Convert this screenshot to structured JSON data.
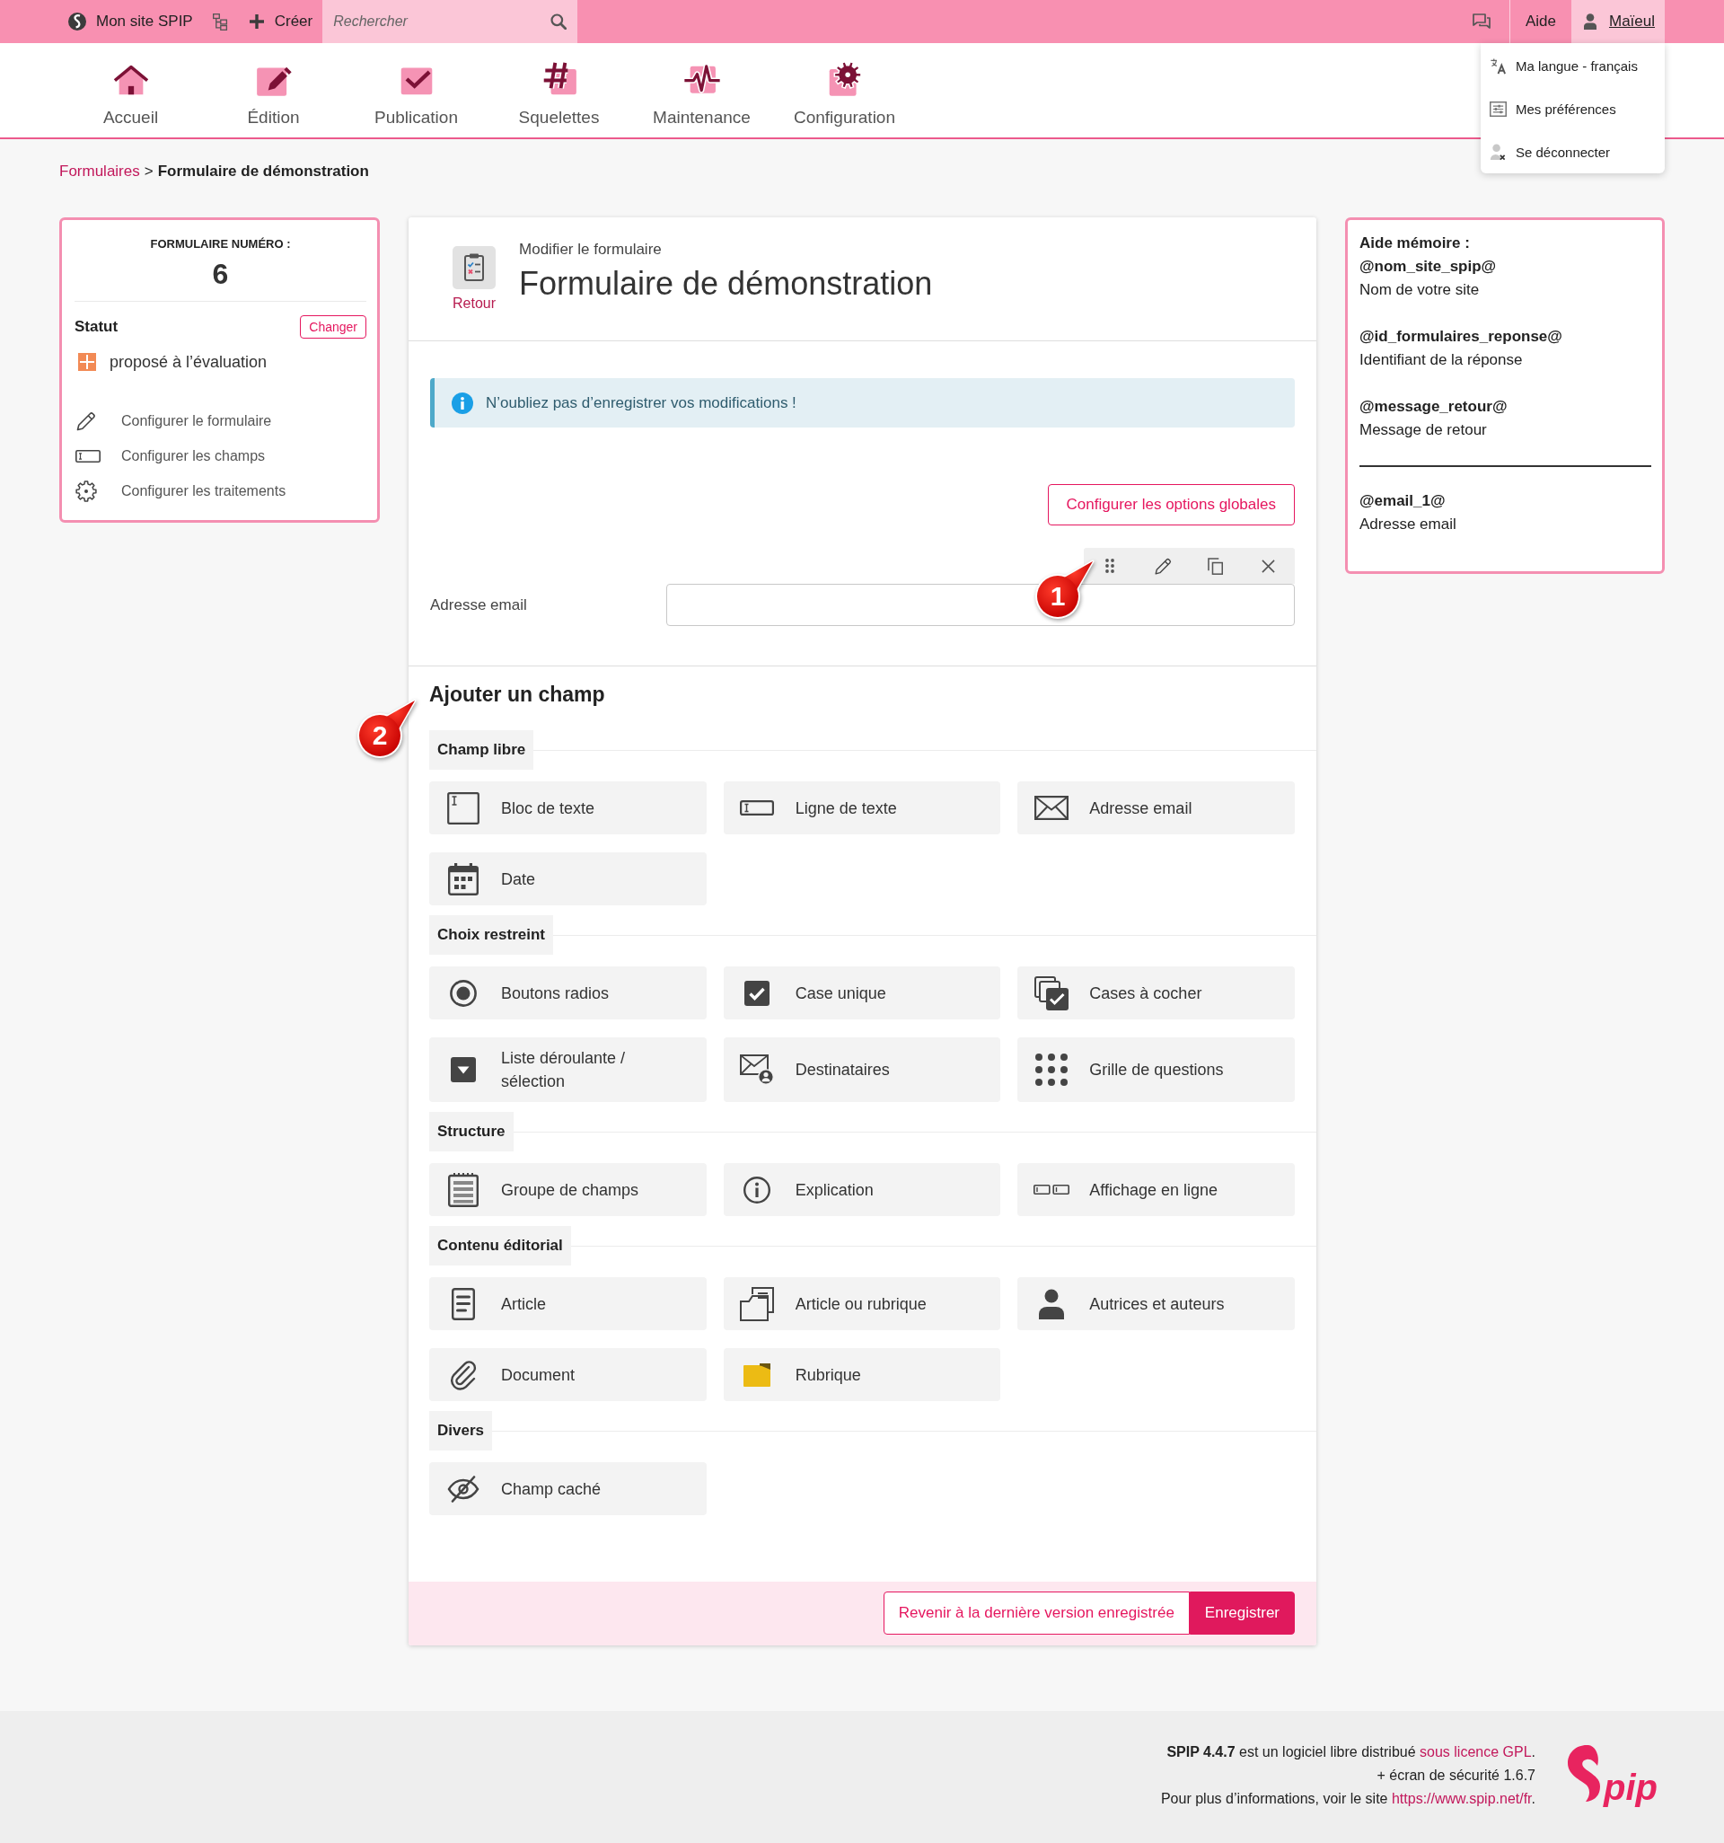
{
  "topbar": {
    "site": "Mon site SPIP",
    "create": "Créer",
    "search": {
      "placeholder": "Rechercher"
    },
    "help": "Aide",
    "user": {
      "name": "Maïeul",
      "expanded": true,
      "menu": [
        "Ma langue - français",
        "Mes préférences",
        "Se déconnecter"
      ]
    }
  },
  "nav": [
    {
      "label": "Accueil",
      "kind": "home"
    },
    {
      "label": "Édition",
      "kind": "edit"
    },
    {
      "label": "Publication",
      "kind": "publish"
    },
    {
      "label": "Squelettes",
      "kind": "templates"
    },
    {
      "label": "Maintenance",
      "kind": "maintenance"
    },
    {
      "label": "Configuration",
      "kind": "config"
    }
  ],
  "breadcrumb": {
    "parent": "Formulaires",
    "separator": ">",
    "current": "Formulaire de démonstration"
  },
  "form_card": {
    "heading": "FORMULAIRE NUMÉRO :",
    "number": "6",
    "status_label": "Statut",
    "change": "Changer",
    "status": "proposé à l’évaluation",
    "actions": [
      {
        "label": "Configurer le formulaire",
        "kind": "edit"
      },
      {
        "label": "Configurer les champs",
        "kind": "fields"
      },
      {
        "label": "Configurer les traitements",
        "kind": "processing"
      }
    ]
  },
  "editor": {
    "back": "Retour",
    "subtitle": "Modifier le formulaire",
    "title": "Formulaire de démonstration",
    "alert": "N’oubliez pas d’enregistrer vos modifications !",
    "global_options": "Configurer les options globales",
    "fields": [
      {
        "label": "Adresse email"
      }
    ],
    "add_title": "Ajouter un champ",
    "sections": [
      {
        "title": "Champ libre",
        "items": [
          {
            "label": "Bloc de texte",
            "kind": "textarea"
          },
          {
            "label": "Ligne de texte",
            "kind": "input"
          },
          {
            "label": "Adresse email",
            "kind": "email"
          },
          {
            "label": "Date",
            "kind": "date"
          }
        ]
      },
      {
        "title": "Choix restreint",
        "items": [
          {
            "label": "Boutons radios",
            "kind": "radio"
          },
          {
            "label": "Case unique",
            "kind": "checkbox"
          },
          {
            "label": "Cases à cocher",
            "kind": "checkboxes"
          },
          {
            "label": "Liste déroulante / sélection",
            "kind": "select"
          },
          {
            "label": "Destinataires",
            "kind": "recipients"
          },
          {
            "label": "Grille de questions",
            "kind": "grid"
          }
        ]
      },
      {
        "title": "Structure",
        "items": [
          {
            "label": "Groupe de champs",
            "kind": "fieldset"
          },
          {
            "label": "Explication",
            "kind": "explanation"
          },
          {
            "label": "Affichage en ligne",
            "kind": "inline"
          }
        ]
      },
      {
        "title": "Contenu éditorial",
        "items": [
          {
            "label": "Article",
            "kind": "article"
          },
          {
            "label": "Article ou rubrique",
            "kind": "selector"
          },
          {
            "label": "Autrices et auteurs",
            "kind": "authors"
          },
          {
            "label": "Document",
            "kind": "document"
          },
          {
            "label": "Rubrique",
            "kind": "section"
          }
        ]
      },
      {
        "title": "Divers",
        "items": [
          {
            "label": "Champ caché",
            "kind": "hidden"
          }
        ]
      }
    ],
    "revert": "Revenir à la dernière version enregistrée",
    "save": "Enregistrer"
  },
  "callouts": [
    "1",
    "2"
  ],
  "memo": {
    "title": "Aide mémoire :",
    "groups": [
      [
        {
          "tag": "@nom_site_spip@",
          "description": "Nom de votre site"
        },
        {
          "tag": "@id_formulaires_reponse@",
          "description": "Identifiant de la réponse"
        },
        {
          "tag": "@message_retour@",
          "description": "Message de retour"
        }
      ],
      [
        {
          "tag": "@email_1@",
          "description": "Adresse email"
        }
      ]
    ]
  },
  "footer": {
    "lines": [
      {
        "text": "**SPIP 4.4.7** est un logiciel libre distribué ",
        "link": "sous licence GPL",
        "after": "."
      },
      {
        "text": "+ écran de sécurité 1.6.7"
      },
      {
        "text": "Pour plus d’informations, voir le site ",
        "link": "https://www.spip.net/fr",
        "after": "."
      }
    ],
    "logo": "pip"
  }
}
